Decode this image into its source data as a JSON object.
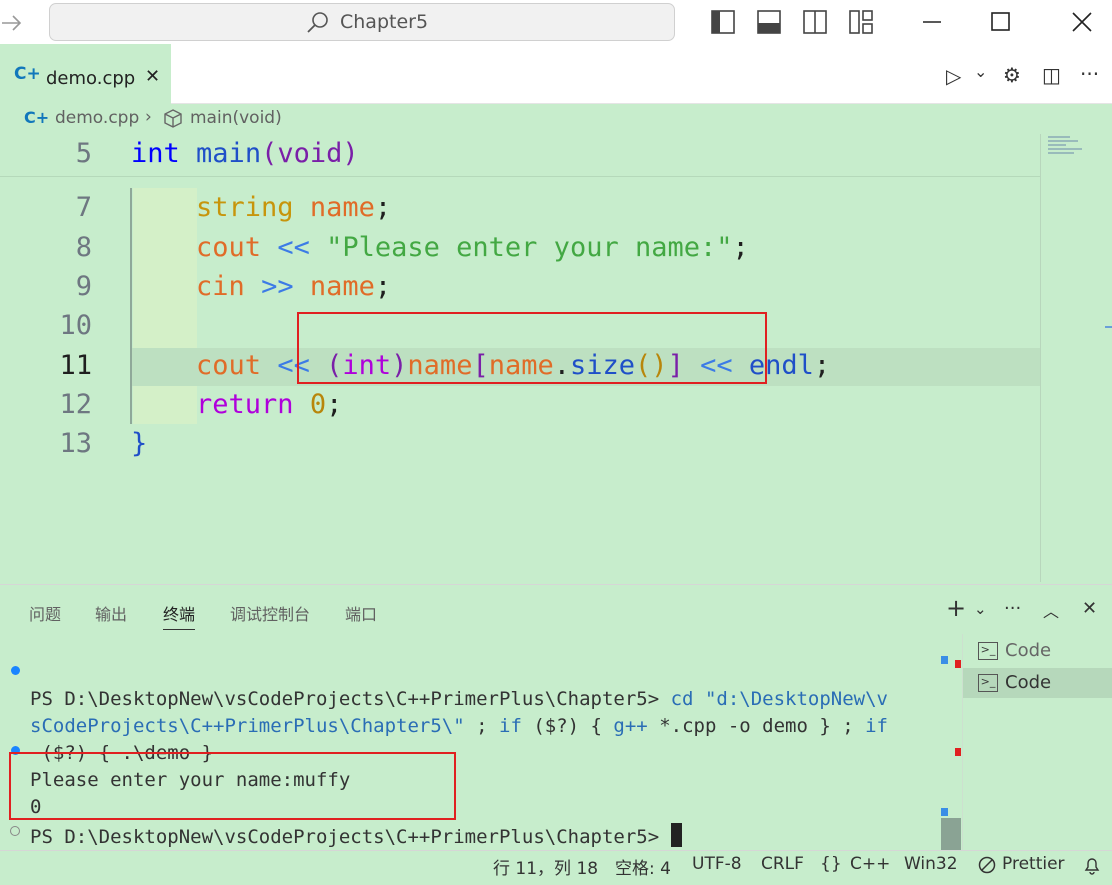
{
  "titlebar": {
    "search_text": "Chapter5",
    "icons": [
      "back-arrow-icon",
      "search-icon",
      "toggle-primary-sidebar-icon",
      "toggle-panel-icon",
      "toggle-secondary-sidebar-icon",
      "customize-layout-icon",
      "minimize-icon",
      "maximize-icon",
      "close-icon"
    ]
  },
  "tab": {
    "label": "demo.cpp",
    "close": "✕",
    "lang_icon": "C+"
  },
  "editor_actions": {
    "run": "▷",
    "dropdown": "⌄",
    "settings": "⚙",
    "split": "◫",
    "more": "···"
  },
  "breadcrumb": {
    "file": "demo.cpp",
    "sep": "›",
    "symbol": "main(void)"
  },
  "code": {
    "lines": [
      {
        "num": "5"
      },
      {
        "num": "7"
      },
      {
        "num": "8"
      },
      {
        "num": "9"
      },
      {
        "num": "10"
      },
      {
        "num": "11"
      },
      {
        "num": "12"
      },
      {
        "num": "13"
      }
    ],
    "t5_int": "int",
    "t5_main": "main",
    "t5_rest": "(void)",
    "t7_type": "string",
    "t7_var": "name",
    "t7_semi": ";",
    "t8_cout": "cout",
    "t8_op": "<<",
    "t8_str": "\"Please enter your name:\"",
    "t8_semi": ";",
    "t9_cin": "cin",
    "t9_op": ">>",
    "t9_var": "name",
    "t9_semi": ";",
    "t11_cout": "cout",
    "t11_op1": "<<",
    "t11_p1": "(",
    "t11_int": "int",
    "t11_p2": ")",
    "t11_name": "name",
    "t11_b1": "[",
    "t11_name2": "name",
    "t11_dot": ".",
    "t11_size": "size",
    "t11_pp": "()",
    "t11_b2": "]",
    "t11_op2": "<<",
    "t11_endl": "endl",
    "t11_semi": ";",
    "t12_ret": "return",
    "t12_num": "0",
    "t12_semi": ";",
    "t13": "}"
  },
  "panel": {
    "tabs": [
      "问题",
      "输出",
      "终端",
      "调试控制台",
      "端口"
    ],
    "active_tab": "终端",
    "actions": {
      "add": "+",
      "dropdown": "⌄",
      "more": "···",
      "maximize": "︿",
      "close": "✕"
    },
    "terminal_list": [
      "Code",
      "Code"
    ]
  },
  "terminal": {
    "l1": "PS D:\\DesktopNew\\vsCodeProjects\\C++PrimerPlus\\Chapter5> ",
    "l1_cmd": "cd",
    "l1_str": "\"d:\\DesktopNew\\v",
    "l2_str": "sCodeProjects\\C++PrimerPlus\\Chapter5\\\"",
    "l2_a": " ; ",
    "l2_if": "if",
    "l2_b": " ($?) { ",
    "l2_gpp": "g++",
    "l2_c": " *.cpp -o demo } ; ",
    "l2_if2": "if",
    "l3": " ($?) { .\\demo }",
    "l4": "Please enter your name:muffy",
    "l5": "0",
    "l6": "PS D:\\DesktopNew\\vsCodeProjects\\C++PrimerPlus\\Chapter5> "
  },
  "status": {
    "position": "行 11，列 18",
    "spaces": "空格: 4",
    "encoding": "UTF-8",
    "eol": "CRLF",
    "lang_braces": "{}",
    "language": "C++",
    "platform": "Win32",
    "prettier": "Prettier"
  },
  "colors": {
    "background": "#c7edcc",
    "highlight_box": "#e02020",
    "accent": "#1177bb"
  }
}
